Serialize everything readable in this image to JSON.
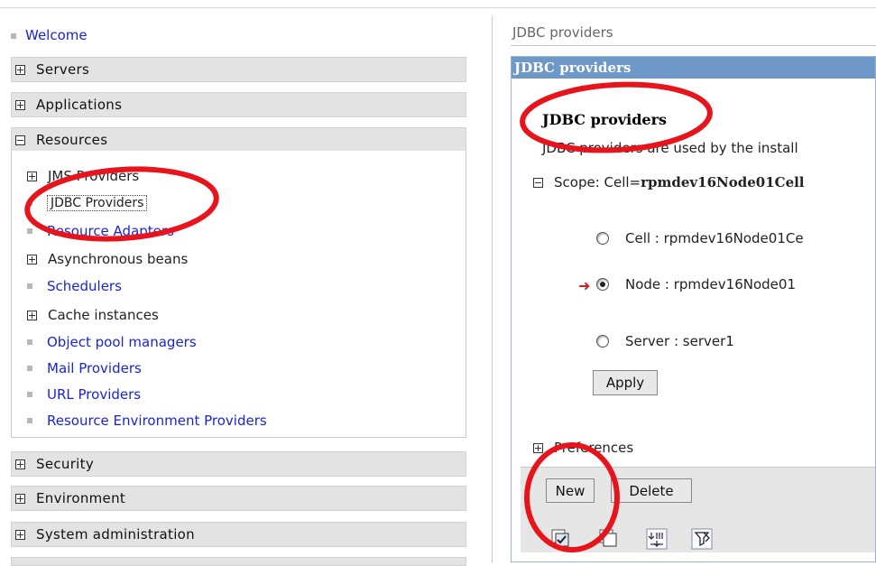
{
  "nav": {
    "welcome": "Welcome",
    "servers": "Servers",
    "applications": "Applications",
    "resources": "Resources",
    "resource_items": {
      "jms": "JMS Providers",
      "jdbc": "JDBC Providers",
      "adapters": "Resource Adapters",
      "async": "Asynchronous beans",
      "schedulers": "Schedulers",
      "cache": "Cache instances",
      "pool": "Object pool managers",
      "mail": "Mail Providers",
      "url": "URL Providers",
      "env": "Resource Environment Providers"
    },
    "security": "Security",
    "environment": "Environment",
    "sysadmin": "System administration"
  },
  "content": {
    "breadcrumb": "JDBC providers",
    "titlebar": "JDBC providers",
    "heading": "JDBC providers",
    "description": "JDBC providers are used by the install",
    "scope_label": "Scope: Cell=",
    "scope_value": "rpmdev16Node01Cell",
    "radios": {
      "cell": "Cell : rpmdev16Node01Ce",
      "node": "Node : rpmdev16Node01",
      "server": "Server : server1"
    },
    "selected_scope": "node",
    "apply": "Apply",
    "preferences": "Preferences",
    "new": "New",
    "delete": "Delete"
  },
  "colors": {
    "titlebar": "#6e98c8",
    "link": "#1a24d6",
    "annotation": "#e8141c"
  }
}
